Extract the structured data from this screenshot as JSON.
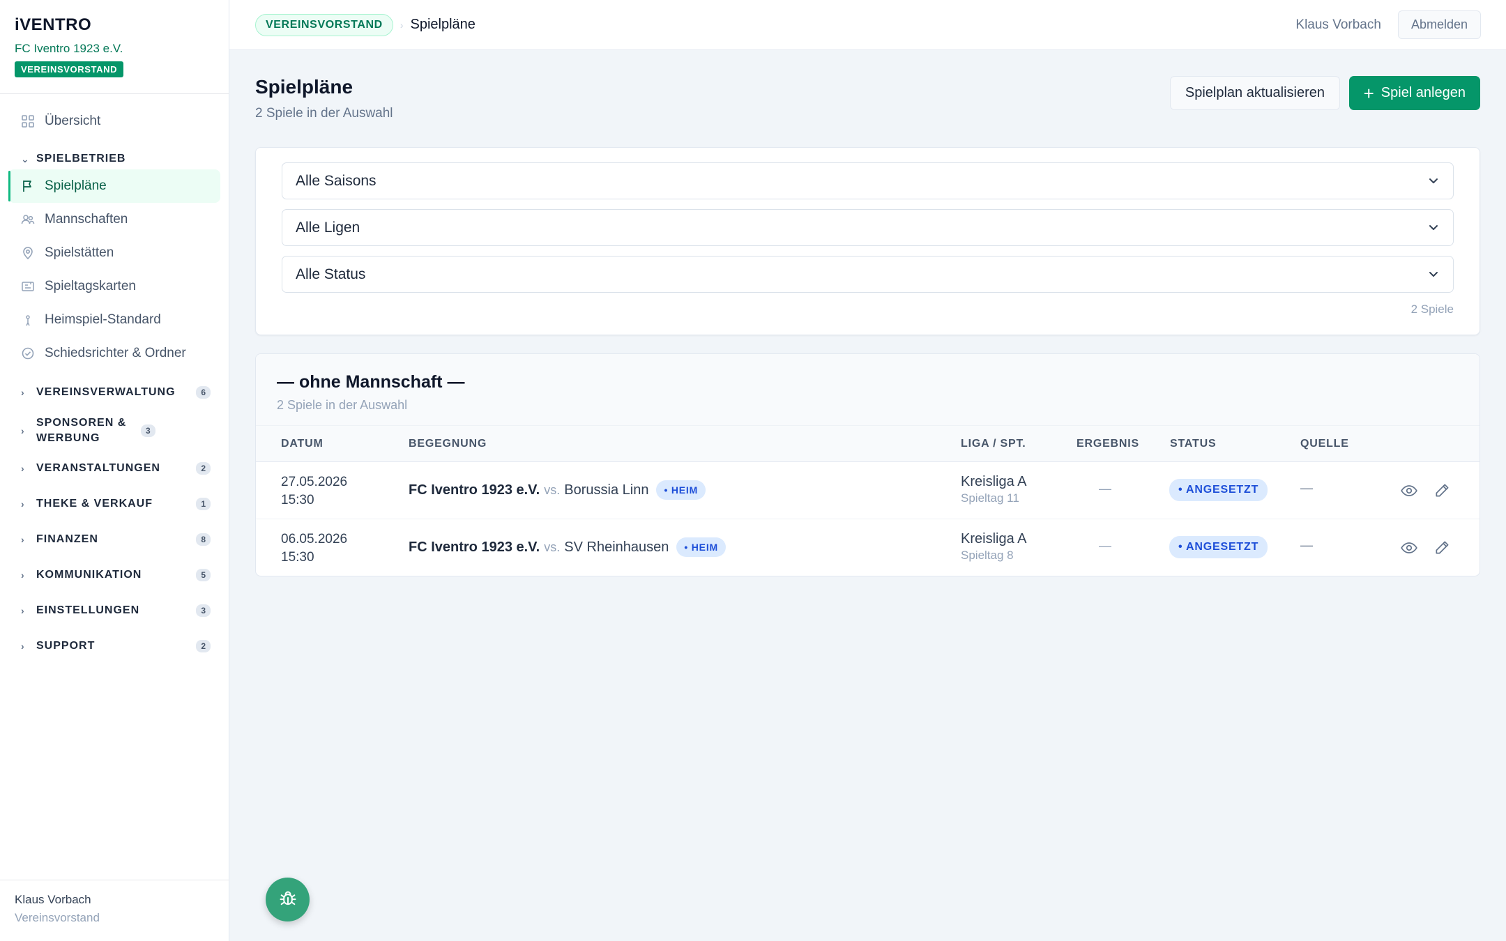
{
  "brand": {
    "logo": "iVENTRO",
    "club": "FC Iventro 1923 e.V.",
    "role": "VEREINSVORSTAND"
  },
  "sidebar": {
    "overview": "Übersicht",
    "section_label": "SPIELBETRIEB",
    "items": [
      {
        "label": "Spielpläne",
        "icon": "flag-icon",
        "active": true
      },
      {
        "label": "Mannschaften",
        "icon": "people-icon"
      },
      {
        "label": "Spielstätten",
        "icon": "location-pin-icon"
      },
      {
        "label": "Spieltagskarten",
        "icon": "ticket-icon"
      },
      {
        "label": "Heimspiel-Standard",
        "icon": "person-icon"
      },
      {
        "label": "Schiedsrichter & Ordner",
        "icon": "check-circle-icon"
      }
    ],
    "groups": [
      {
        "label": "VEREINSVERWALTUNG",
        "count": "6"
      },
      {
        "label": "SPONSOREN & WERBUNG",
        "count": "3"
      },
      {
        "label": "VERANSTALTUNGEN",
        "count": "2"
      },
      {
        "label": "THEKE & VERKAUF",
        "count": "1"
      },
      {
        "label": "FINANZEN",
        "count": "8"
      },
      {
        "label": "KOMMUNIKATION",
        "count": "5"
      },
      {
        "label": "EINSTELLUNGEN",
        "count": "3"
      },
      {
        "label": "SUPPORT",
        "count": "2"
      }
    ],
    "footer": {
      "name": "Klaus Vorbach",
      "role": "Vereinsvorstand"
    }
  },
  "topbar": {
    "badge": "VEREINSVORSTAND",
    "separator": "›",
    "title": "Spielpläne",
    "user": "Klaus Vorbach",
    "logout": "Abmelden"
  },
  "page": {
    "title": "Spielpläne",
    "subtitle": "2 Spiele in der Auswahl",
    "btn_refresh": "Spielplan aktualisieren",
    "btn_add": "Spiel anlegen"
  },
  "filters": {
    "season": "Alle Saisons",
    "league": "Alle Ligen",
    "status": "Alle Status",
    "count": "2 Spiele"
  },
  "table": {
    "group_title": "— ohne Mannschaft —",
    "group_subtitle": "2 Spiele in der Auswahl",
    "columns": [
      "DATUM",
      "BEGEGNUNG",
      "LIGA / SPT.",
      "ERGEBNIS",
      "STATUS",
      "QUELLE"
    ],
    "rows": [
      {
        "date": "27.05.2026",
        "time": "15:30",
        "home": "FC Iventro 1923 e.V.",
        "vs": "vs.",
        "away": "Borussia Linn",
        "badge": "• HEIM",
        "liga": "Kreisliga A",
        "spieltag": "Spieltag 11",
        "result": "—",
        "status": "• ANGESETZT",
        "source": "—"
      },
      {
        "date": "06.05.2026",
        "time": "15:30",
        "home": "FC Iventro 1923 e.V.",
        "vs": "vs.",
        "away": "SV Rheinhausen",
        "badge": "• HEIM",
        "liga": "Kreisliga A",
        "spieltag": "Spieltag 8",
        "result": "—",
        "status": "• ANGESETZT",
        "source": "—"
      }
    ]
  },
  "colors": {
    "accent": "#059669",
    "accent_light": "#ecfdf5",
    "status_blue": "#1d4ed8",
    "status_blue_bg": "#dbeafe"
  }
}
